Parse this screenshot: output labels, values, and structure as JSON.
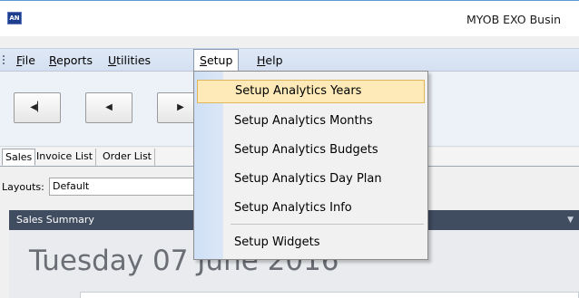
{
  "window": {
    "title": "MYOB EXO Busin",
    "icon_text": "AN",
    "icon": "app-icon"
  },
  "menubar": {
    "items": [
      {
        "label": "File",
        "key": "F",
        "rest": "ile"
      },
      {
        "label": "Reports",
        "key": "R",
        "rest": "eports"
      },
      {
        "label": "Utilities",
        "key": "U",
        "rest": "tilities"
      },
      {
        "label": "Setup",
        "key": "S",
        "rest": "etup"
      },
      {
        "label": "Help",
        "key": "H",
        "rest": "elp"
      }
    ],
    "active": "Setup"
  },
  "toolbar": {
    "buttons": [
      {
        "name": "first-record",
        "icon": "skip-first-icon",
        "glyph": "◀▏"
      },
      {
        "name": "previous-record",
        "icon": "previous-icon",
        "glyph": "◀"
      },
      {
        "name": "next-record",
        "icon": "next-icon",
        "glyph": "▶"
      }
    ]
  },
  "tabs": [
    {
      "label": "Sales",
      "selected": true
    },
    {
      "label": "Invoice List"
    },
    {
      "label": "Order List"
    }
  ],
  "layouts": {
    "label": "Layouts:",
    "value": "Default"
  },
  "panel": {
    "title": "Sales Summary",
    "date": "Tuesday 07 June 2016"
  },
  "setup_menu": {
    "items": [
      {
        "label": "Setup Analytics Years",
        "highlighted": true
      },
      {
        "label": "Setup Analytics Months"
      },
      {
        "label": "Setup Analytics Budgets"
      },
      {
        "label": "Setup Analytics Day Plan"
      },
      {
        "label": "Setup Analytics Info"
      },
      {
        "label": "Setup Widgets"
      }
    ]
  },
  "colors": {
    "menubar": "#d8e3f3",
    "highlight": "#fdeab8",
    "highlight_border": "#e1b65a",
    "panel_header": "#404c60"
  }
}
